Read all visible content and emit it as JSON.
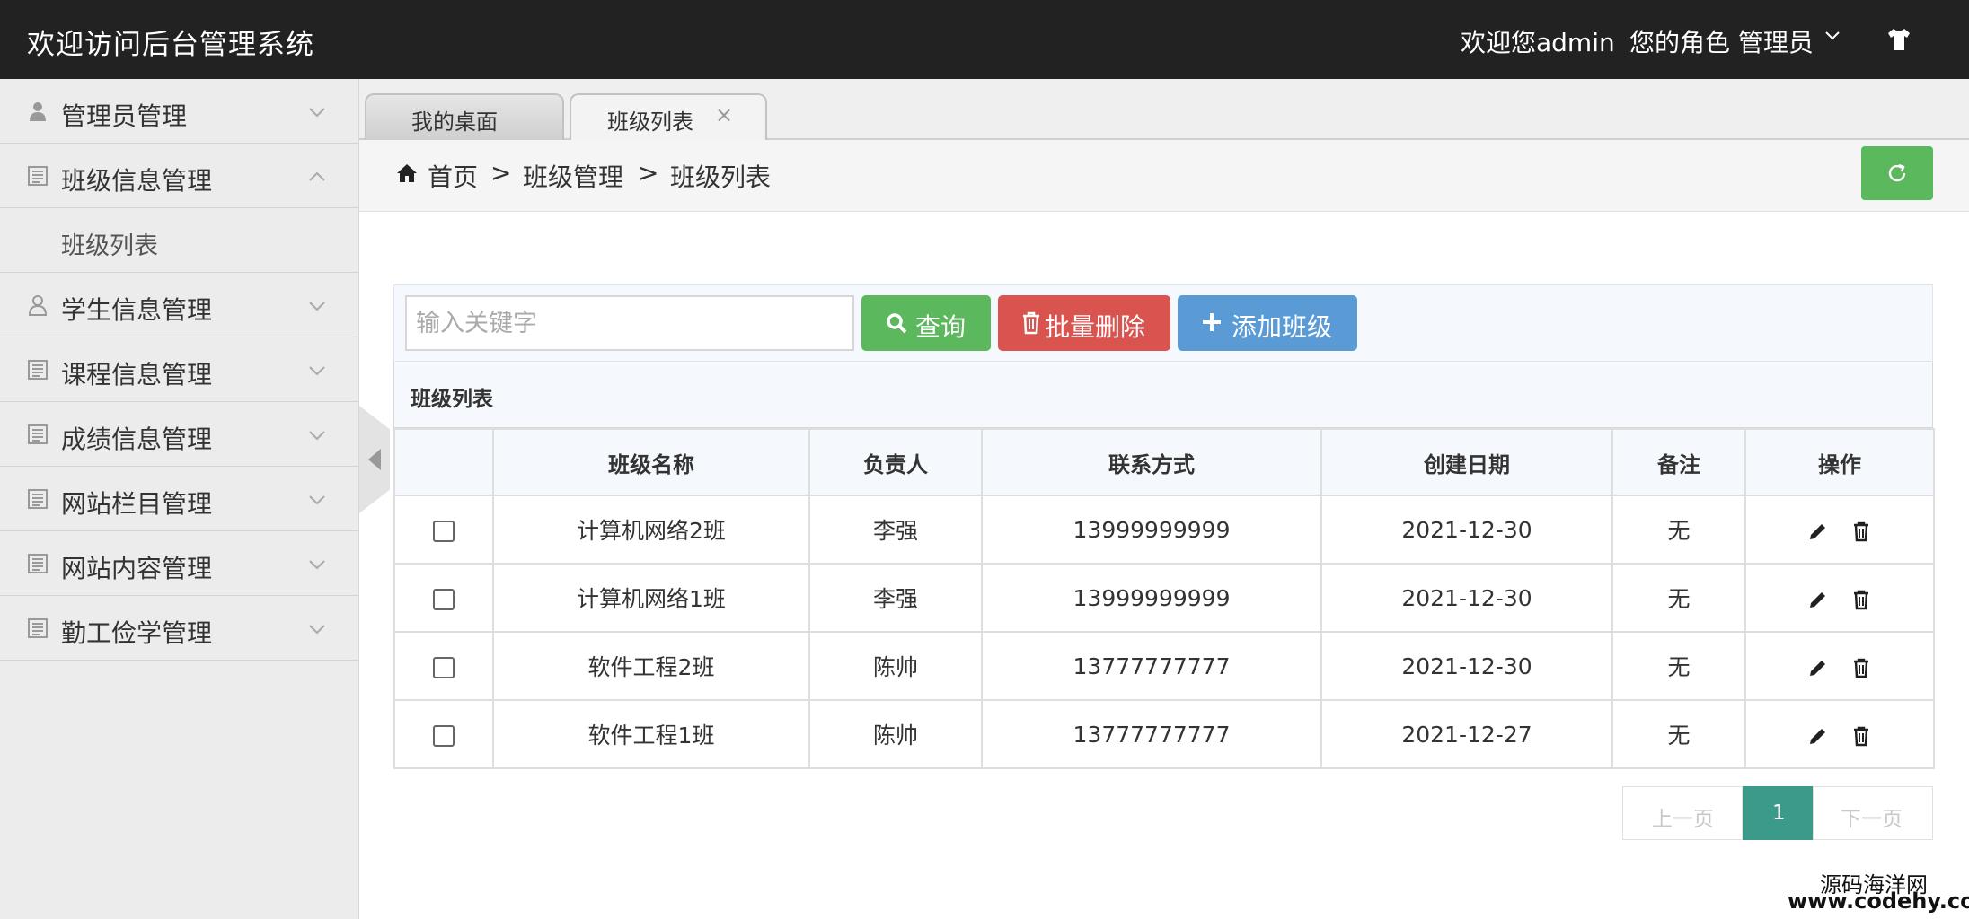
{
  "header": {
    "title": "欢迎访问后台管理系统",
    "welcome": "欢迎您admin",
    "role": "您的角色 管理员"
  },
  "sidebar": {
    "items": [
      {
        "label": "管理员管理",
        "icon": "user-icon",
        "expanded": false
      },
      {
        "label": "班级信息管理",
        "icon": "document-icon",
        "expanded": true
      },
      {
        "label": "学生信息管理",
        "icon": "user-outline-icon",
        "expanded": false
      },
      {
        "label": "课程信息管理",
        "icon": "document-icon",
        "expanded": false
      },
      {
        "label": "成绩信息管理",
        "icon": "document-icon",
        "expanded": false
      },
      {
        "label": "网站栏目管理",
        "icon": "document-icon",
        "expanded": false
      },
      {
        "label": "网站内容管理",
        "icon": "document-icon",
        "expanded": false
      },
      {
        "label": "勤工俭学管理",
        "icon": "document-icon",
        "expanded": false
      }
    ],
    "subitems": [
      {
        "label": "班级列表"
      }
    ]
  },
  "tabs": [
    {
      "label": "我的桌面",
      "active": false
    },
    {
      "label": "班级列表",
      "active": true,
      "close": "×"
    }
  ],
  "breadcrumb": {
    "home": "首页",
    "sep": ">",
    "level2": "班级管理",
    "level3": "班级列表"
  },
  "toolbar": {
    "search_placeholder": "输入关键字",
    "query_label": "查询",
    "delete_label": "批量删除",
    "add_label": "添加班级"
  },
  "table": {
    "title": "班级列表",
    "columns": [
      "",
      "班级名称",
      "负责人",
      "联系方式",
      "创建日期",
      "备注",
      "操作"
    ],
    "rows": [
      {
        "name": "计算机网络2班",
        "owner": "李强",
        "phone": "13999999999",
        "date": "2021-12-30",
        "note": "无"
      },
      {
        "name": "计算机网络1班",
        "owner": "李强",
        "phone": "13999999999",
        "date": "2021-12-30",
        "note": "无"
      },
      {
        "name": "软件工程2班",
        "owner": "陈帅",
        "phone": "13777777777",
        "date": "2021-12-30",
        "note": "无"
      },
      {
        "name": "软件工程1班",
        "owner": "陈帅",
        "phone": "13777777777",
        "date": "2021-12-27",
        "note": "无"
      }
    ]
  },
  "pagination": {
    "prev": "上一页",
    "current": "1",
    "next": "下一页"
  },
  "watermark": {
    "line1": "源码海洋网",
    "line2": "www.codehy.com"
  },
  "colors": {
    "topbar": "#222222",
    "success": "#5cb85c",
    "danger": "#d9534f",
    "primary": "#5b9bd5",
    "pager_active": "#3c9a8a"
  }
}
